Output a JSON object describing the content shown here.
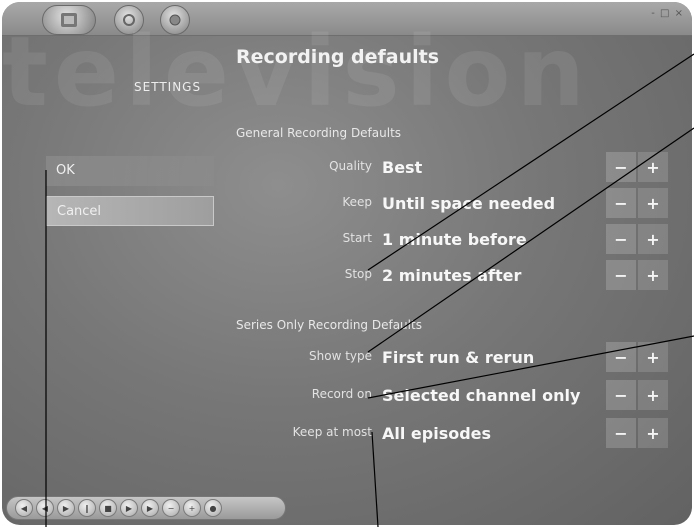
{
  "watermark": "television",
  "settings_label": "SETTINGS",
  "page_title": "Recording defaults",
  "window_controls": "- □ ×",
  "sections": {
    "general": "General Recording Defaults",
    "series": "Series Only Recording Defaults"
  },
  "sidebar": {
    "ok": "OK",
    "cancel": "Cancel"
  },
  "rows": [
    {
      "label": "Quality",
      "value": "Best"
    },
    {
      "label": "Keep",
      "value": "Until space needed"
    },
    {
      "label": "Start",
      "value": "1 minute before"
    },
    {
      "label": "Stop",
      "value": "2 minutes after"
    },
    {
      "label": "Show type",
      "value": "First run & rerun"
    },
    {
      "label": "Record on",
      "value": "Selected channel only"
    },
    {
      "label": "Keep at most",
      "value": "All episodes"
    }
  ],
  "controls": {
    "minus": "−",
    "plus": "+"
  },
  "top_icons": [
    "media-center-icon",
    "back-icon",
    "home-icon"
  ],
  "transport": [
    "skip-back-icon",
    "rewind-icon",
    "play-icon",
    "pause-icon",
    "stop-icon",
    "fast-forward-icon",
    "skip-forward-icon",
    "volume-down-icon",
    "volume-up-icon",
    "mute-icon"
  ]
}
